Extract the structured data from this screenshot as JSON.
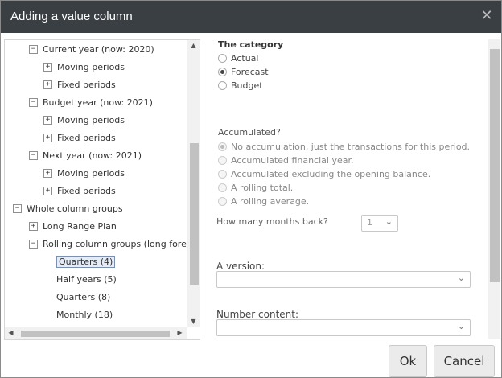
{
  "dialog": {
    "title": "Adding a value column",
    "close_icon": "close-icon"
  },
  "tree": {
    "items": [
      {
        "label": "Current year (now: 2020)",
        "toggle": "−",
        "level": 1
      },
      {
        "label": "Moving periods",
        "toggle": "+",
        "level": 2
      },
      {
        "label": "Fixed periods",
        "toggle": "+",
        "level": 2
      },
      {
        "label": "Budget year (now: 2021)",
        "toggle": "−",
        "level": 1
      },
      {
        "label": "Moving periods",
        "toggle": "+",
        "level": 2
      },
      {
        "label": "Fixed periods",
        "toggle": "+",
        "level": 2
      },
      {
        "label": "Next year (now: 2021)",
        "toggle": "−",
        "level": 1
      },
      {
        "label": "Moving periods",
        "toggle": "+",
        "level": 2
      },
      {
        "label": "Fixed periods",
        "toggle": "+",
        "level": 2
      },
      {
        "label": "Whole column groups",
        "toggle": "−",
        "level": 0
      },
      {
        "label": "Long Range Plan",
        "toggle": "+",
        "level": 1
      },
      {
        "label": "Rolling column groups (long forecast)",
        "toggle": "−",
        "level": 1
      },
      {
        "label": "Quarters (4)",
        "level": 3,
        "selected": true
      },
      {
        "label": "Half years (5)",
        "level": 3
      },
      {
        "label": "Quarters (8)",
        "level": 3
      },
      {
        "label": "Monthly (18)",
        "level": 3
      }
    ]
  },
  "category": {
    "label": "The category",
    "options": [
      {
        "label": "Actual",
        "checked": false
      },
      {
        "label": "Forecast",
        "checked": true
      },
      {
        "label": "Budget",
        "checked": false
      }
    ]
  },
  "accumulated": {
    "label": "Accumulated?",
    "options": [
      {
        "label": "No accumulation, just the transactions for this period.",
        "checked": true
      },
      {
        "label": "Accumulated financial year.",
        "checked": false
      },
      {
        "label": "Accumulated excluding the opening balance.",
        "checked": false
      },
      {
        "label": "A rolling total.",
        "checked": false
      },
      {
        "label": "A rolling average.",
        "checked": false
      }
    ],
    "months_back_label": "How many months back?",
    "months_back_value": "1"
  },
  "version": {
    "label": "A version:",
    "value": ""
  },
  "number_content": {
    "label": "Number content:",
    "value": ""
  },
  "footer": {
    "ok_label": "Ok",
    "cancel_label": "Cancel"
  }
}
